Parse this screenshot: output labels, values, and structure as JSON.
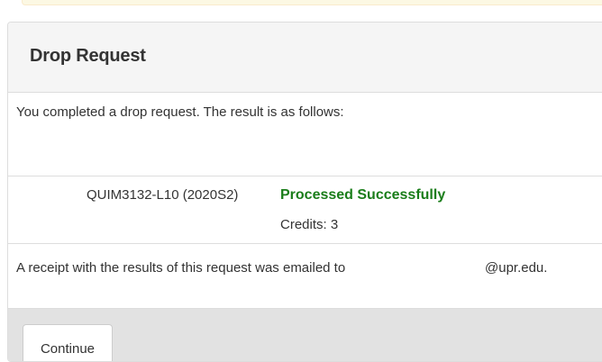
{
  "panel": {
    "title": "Drop Request",
    "intro": "You completed a drop request. The result is as follows:"
  },
  "result": {
    "course": "QUIM3132-L10 (2020S2)",
    "status": "Processed Successfully",
    "credits": "Credits: 3",
    "status_color": "#1a7d1a"
  },
  "receipt": {
    "text": "A receipt with the results of this request was emailed to",
    "email_domain": "@upr.edu."
  },
  "footer": {
    "continue_label": "Continue"
  }
}
